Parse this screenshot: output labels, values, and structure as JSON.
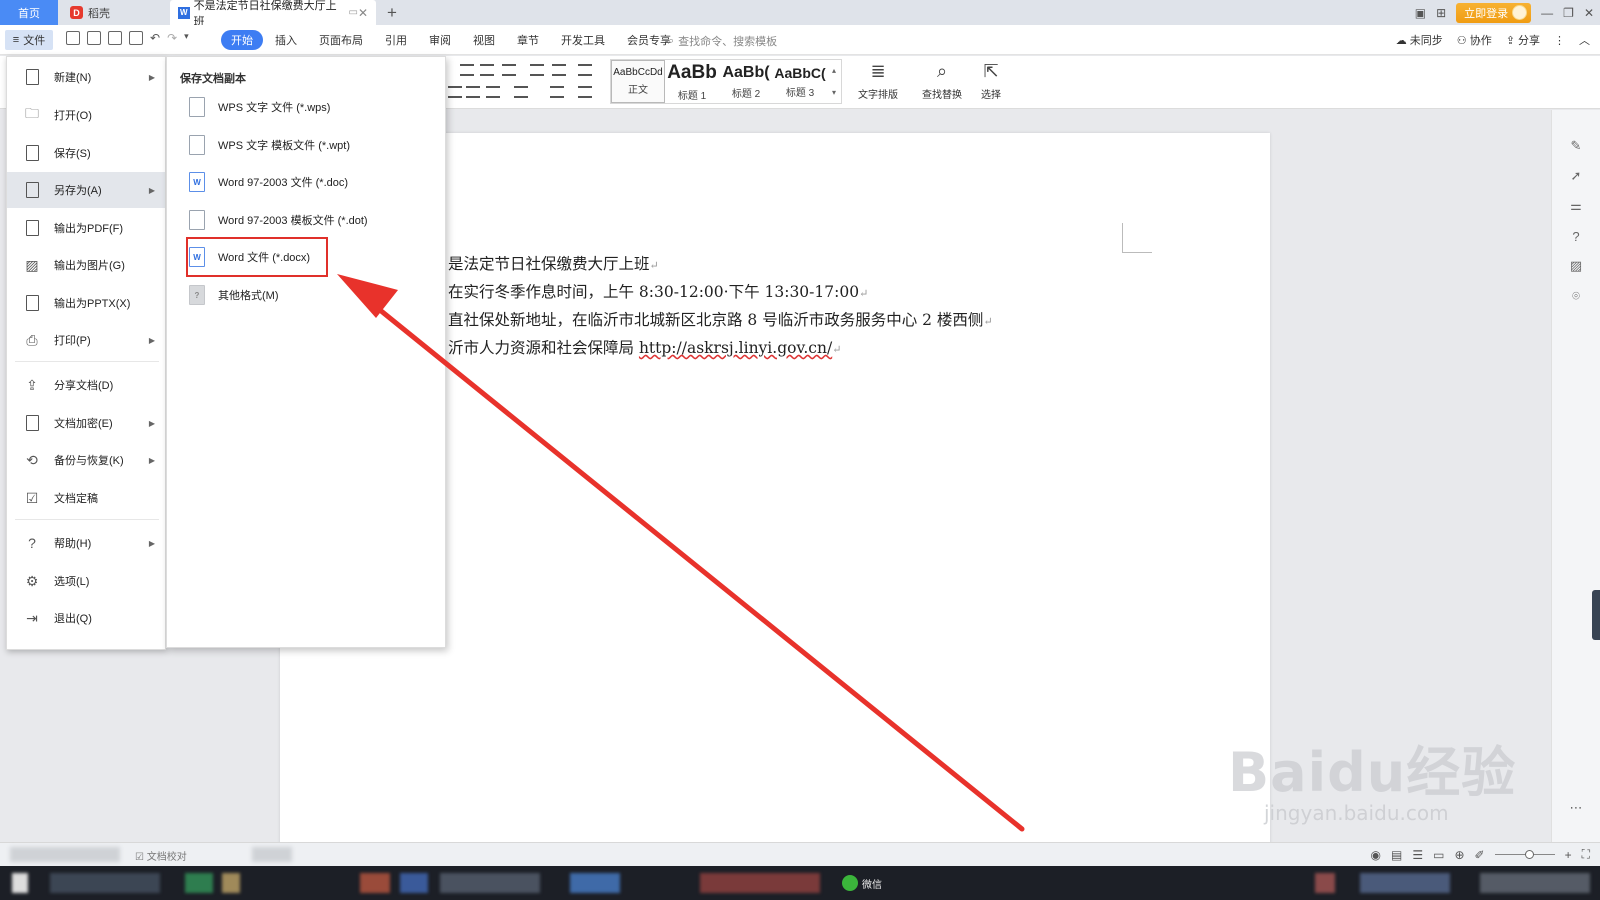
{
  "tabs": {
    "home": "首页",
    "daoke": "稻壳",
    "doc": "不是法定节日社保缴费大厅上班",
    "add": "+"
  },
  "window": {
    "login": "立即登录",
    "minimize": "—",
    "restore": "❐",
    "close": "✕"
  },
  "menu": {
    "file": "文件",
    "ribbon_tabs": [
      "开始",
      "插入",
      "页面布局",
      "引用",
      "审阅",
      "视图",
      "章节",
      "开发工具",
      "会员专享"
    ],
    "active_tab": "开始",
    "search_placeholder": "查找命令、搜索模板",
    "right_actions": [
      "未同步",
      "协作",
      "分享"
    ]
  },
  "toolbar": {
    "styles": [
      {
        "sample": "AaBbCcDd",
        "name": "正文"
      },
      {
        "sample": "AaBb",
        "name": "标题 1"
      },
      {
        "sample": "AaBb(",
        "name": "标题 2"
      },
      {
        "sample": "AaBbC(",
        "name": "标题 3"
      }
    ],
    "text_layout": "文字排版",
    "find_replace": "查找替换",
    "select": "选择"
  },
  "file_menu": {
    "items": [
      {
        "label": "新建(N)",
        "icon": "new-doc-icon",
        "submenu": true
      },
      {
        "label": "打开(O)",
        "icon": "folder-icon",
        "submenu": false
      },
      {
        "label": "保存(S)",
        "icon": "save-icon",
        "submenu": false
      },
      {
        "label": "另存为(A)",
        "icon": "save-as-icon",
        "submenu": true,
        "active": true
      },
      {
        "label": "输出为PDF(F)",
        "icon": "pdf-icon",
        "submenu": false
      },
      {
        "label": "输出为图片(G)",
        "icon": "image-icon",
        "submenu": false
      },
      {
        "label": "输出为PPTX(X)",
        "icon": "pptx-icon",
        "submenu": false
      },
      {
        "label": "打印(P)",
        "icon": "print-icon",
        "submenu": true
      },
      {
        "label": "分享文档(D)",
        "icon": "share-icon",
        "submenu": false
      },
      {
        "label": "文档加密(E)",
        "icon": "lock-doc-icon",
        "submenu": true
      },
      {
        "label": "备份与恢复(K)",
        "icon": "backup-icon",
        "submenu": true
      },
      {
        "label": "文档定稿",
        "icon": "finalize-icon",
        "submenu": false
      },
      {
        "label": "帮助(H)",
        "icon": "help-icon",
        "submenu": true
      },
      {
        "label": "选项(L)",
        "icon": "gear-icon",
        "submenu": false
      },
      {
        "label": "退出(Q)",
        "icon": "exit-icon",
        "submenu": false
      }
    ]
  },
  "save_as": {
    "title": "保存文档副本",
    "items": [
      {
        "label": "WPS 文字 文件 (*.wps)"
      },
      {
        "label": "WPS 文字 模板文件 (*.wpt)"
      },
      {
        "label": "Word 97-2003 文件 (*.doc)"
      },
      {
        "label": "Word 97-2003 模板文件 (*.dot)"
      },
      {
        "label": "Word 文件 (*.docx)",
        "highlighted": true
      },
      {
        "label": "其他格式(M)"
      }
    ]
  },
  "document": {
    "lines": [
      "是法定节日社保缴费大厅上班",
      "在实行冬季作息时间，上午 8:30-12:00·下午 13:30-17:00",
      "直社保处新地址，在临沂市北城新区北京路 8 号临沂市政务服务中心 2 楼西侧",
      "沂市人力资源和社会保障局 "
    ],
    "link": "http://askrsj.linyi.gov.cn/",
    "para_mark": "↵"
  },
  "statusbar": {
    "proofread": "文档校对",
    "zoom_in": "+",
    "fullscreen": "⛶"
  },
  "taskbar": {
    "wechat": "微信"
  },
  "watermark": {
    "main": "Baidu经验",
    "sub": "jingyan.baidu.com"
  },
  "colors": {
    "accent": "#3d7df3",
    "highlight_box": "#e0302a",
    "annotation_arrow": "#e8322b",
    "login": "#f09c13"
  }
}
